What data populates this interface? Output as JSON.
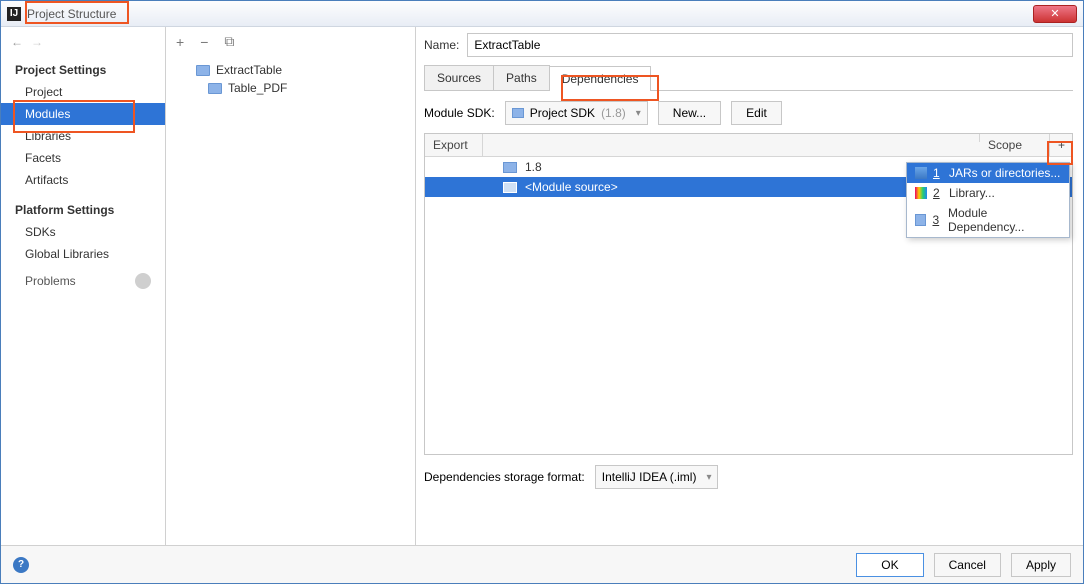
{
  "window": {
    "title": "Project Structure"
  },
  "left": {
    "projectSettings": "Project Settings",
    "project": "Project",
    "modules": "Modules",
    "libraries": "Libraries",
    "facets": "Facets",
    "artifacts": "Artifacts",
    "platformSettings": "Platform Settings",
    "sdks": "SDKs",
    "globalLibraries": "Global Libraries",
    "problems": "Problems"
  },
  "tree": {
    "root": "ExtractTable",
    "child": "Table_PDF"
  },
  "right": {
    "nameLabel": "Name:",
    "nameValue": "ExtractTable",
    "tabs": {
      "sources": "Sources",
      "paths": "Paths",
      "dependencies": "Dependencies"
    },
    "sdkLabel": "Module SDK:",
    "sdkValue": "Project SDK",
    "sdkVersion": "(1.8)",
    "newBtn": "New...",
    "editBtn": "Edit",
    "table": {
      "exportHeader": "Export",
      "scopeHeader": "Scope",
      "plus": "+",
      "row1": "1.8",
      "row2": "<Module source>"
    },
    "popup": {
      "item1": "JARs or directories...",
      "item2": "Library...",
      "item3": "Module Dependency..."
    },
    "storageLabel": "Dependencies storage format:",
    "storageValue": "IntelliJ IDEA (.iml)"
  },
  "footer": {
    "ok": "OK",
    "cancel": "Cancel",
    "apply": "Apply"
  }
}
